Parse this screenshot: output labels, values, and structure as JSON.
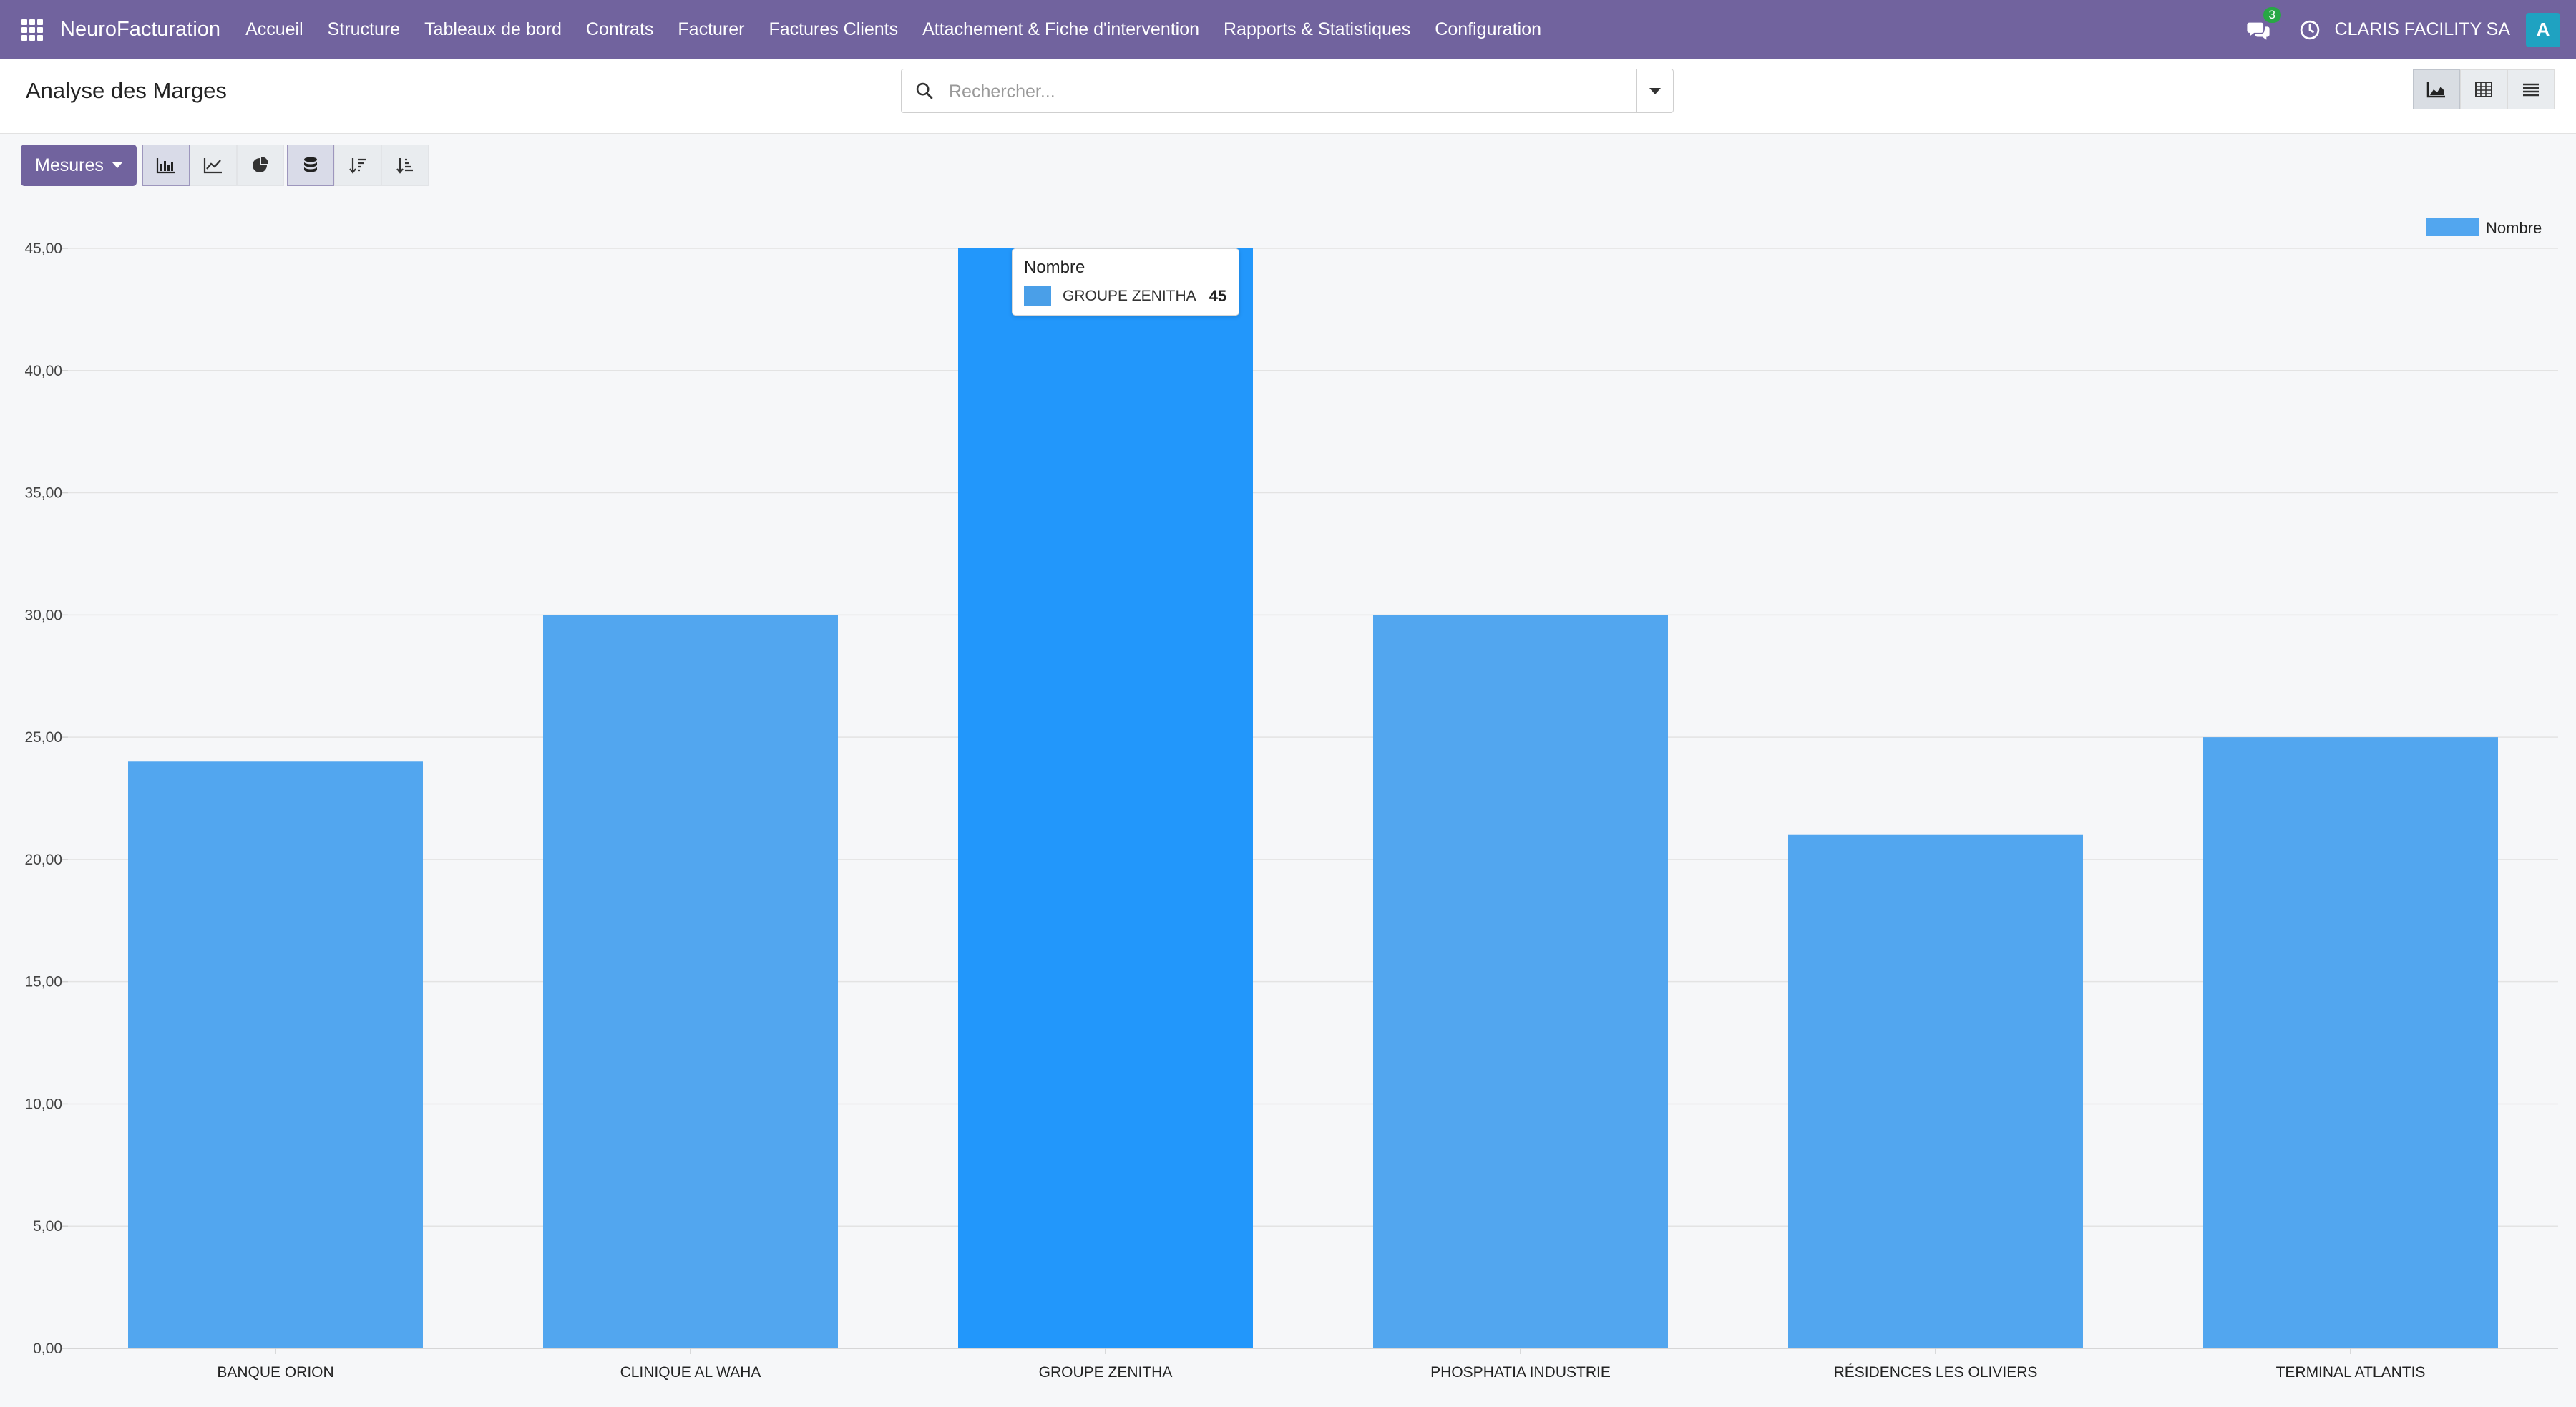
{
  "navbar": {
    "brand": "NeuroFacturation",
    "menu": [
      "Accueil",
      "Structure",
      "Tableaux de bord",
      "Contrats",
      "Facturer",
      "Factures Clients",
      "Attachement & Fiche d'intervention",
      "Rapports & Statistiques",
      "Configuration"
    ],
    "chat_badge": "3",
    "company": "CLARIS FACILITY SA",
    "avatar_letter": "A",
    "color": "#71639e"
  },
  "control": {
    "title": "Analyse des Marges",
    "search_placeholder": "Rechercher..."
  },
  "toolbar": {
    "measures_label": "Mesures"
  },
  "tooltip": {
    "title": "Nombre",
    "label": "GROUPE ZENITHA",
    "value": "45"
  },
  "chart_data": {
    "type": "bar",
    "categories": [
      "BANQUE ORION",
      "CLINIQUE AL WAHA",
      "GROUPE ZENITHA",
      "PHOSPHATIA INDUSTRIE",
      "RÉSIDENCES LES OLIVIERS",
      "TERMINAL ATLANTIS"
    ],
    "series": [
      {
        "name": "Nombre",
        "values": [
          24,
          30,
          45,
          30,
          21,
          25
        ]
      }
    ],
    "ylim": [
      0,
      45
    ],
    "yticks": [
      "0,00",
      "5,00",
      "10,00",
      "15,00",
      "20,00",
      "25,00",
      "30,00",
      "35,00",
      "40,00",
      "45,00"
    ],
    "highlighted_index": 2,
    "bar_color": "#52a6ef",
    "highlight_color": "#2297fb",
    "legend_position": "top-right",
    "grid": true
  }
}
